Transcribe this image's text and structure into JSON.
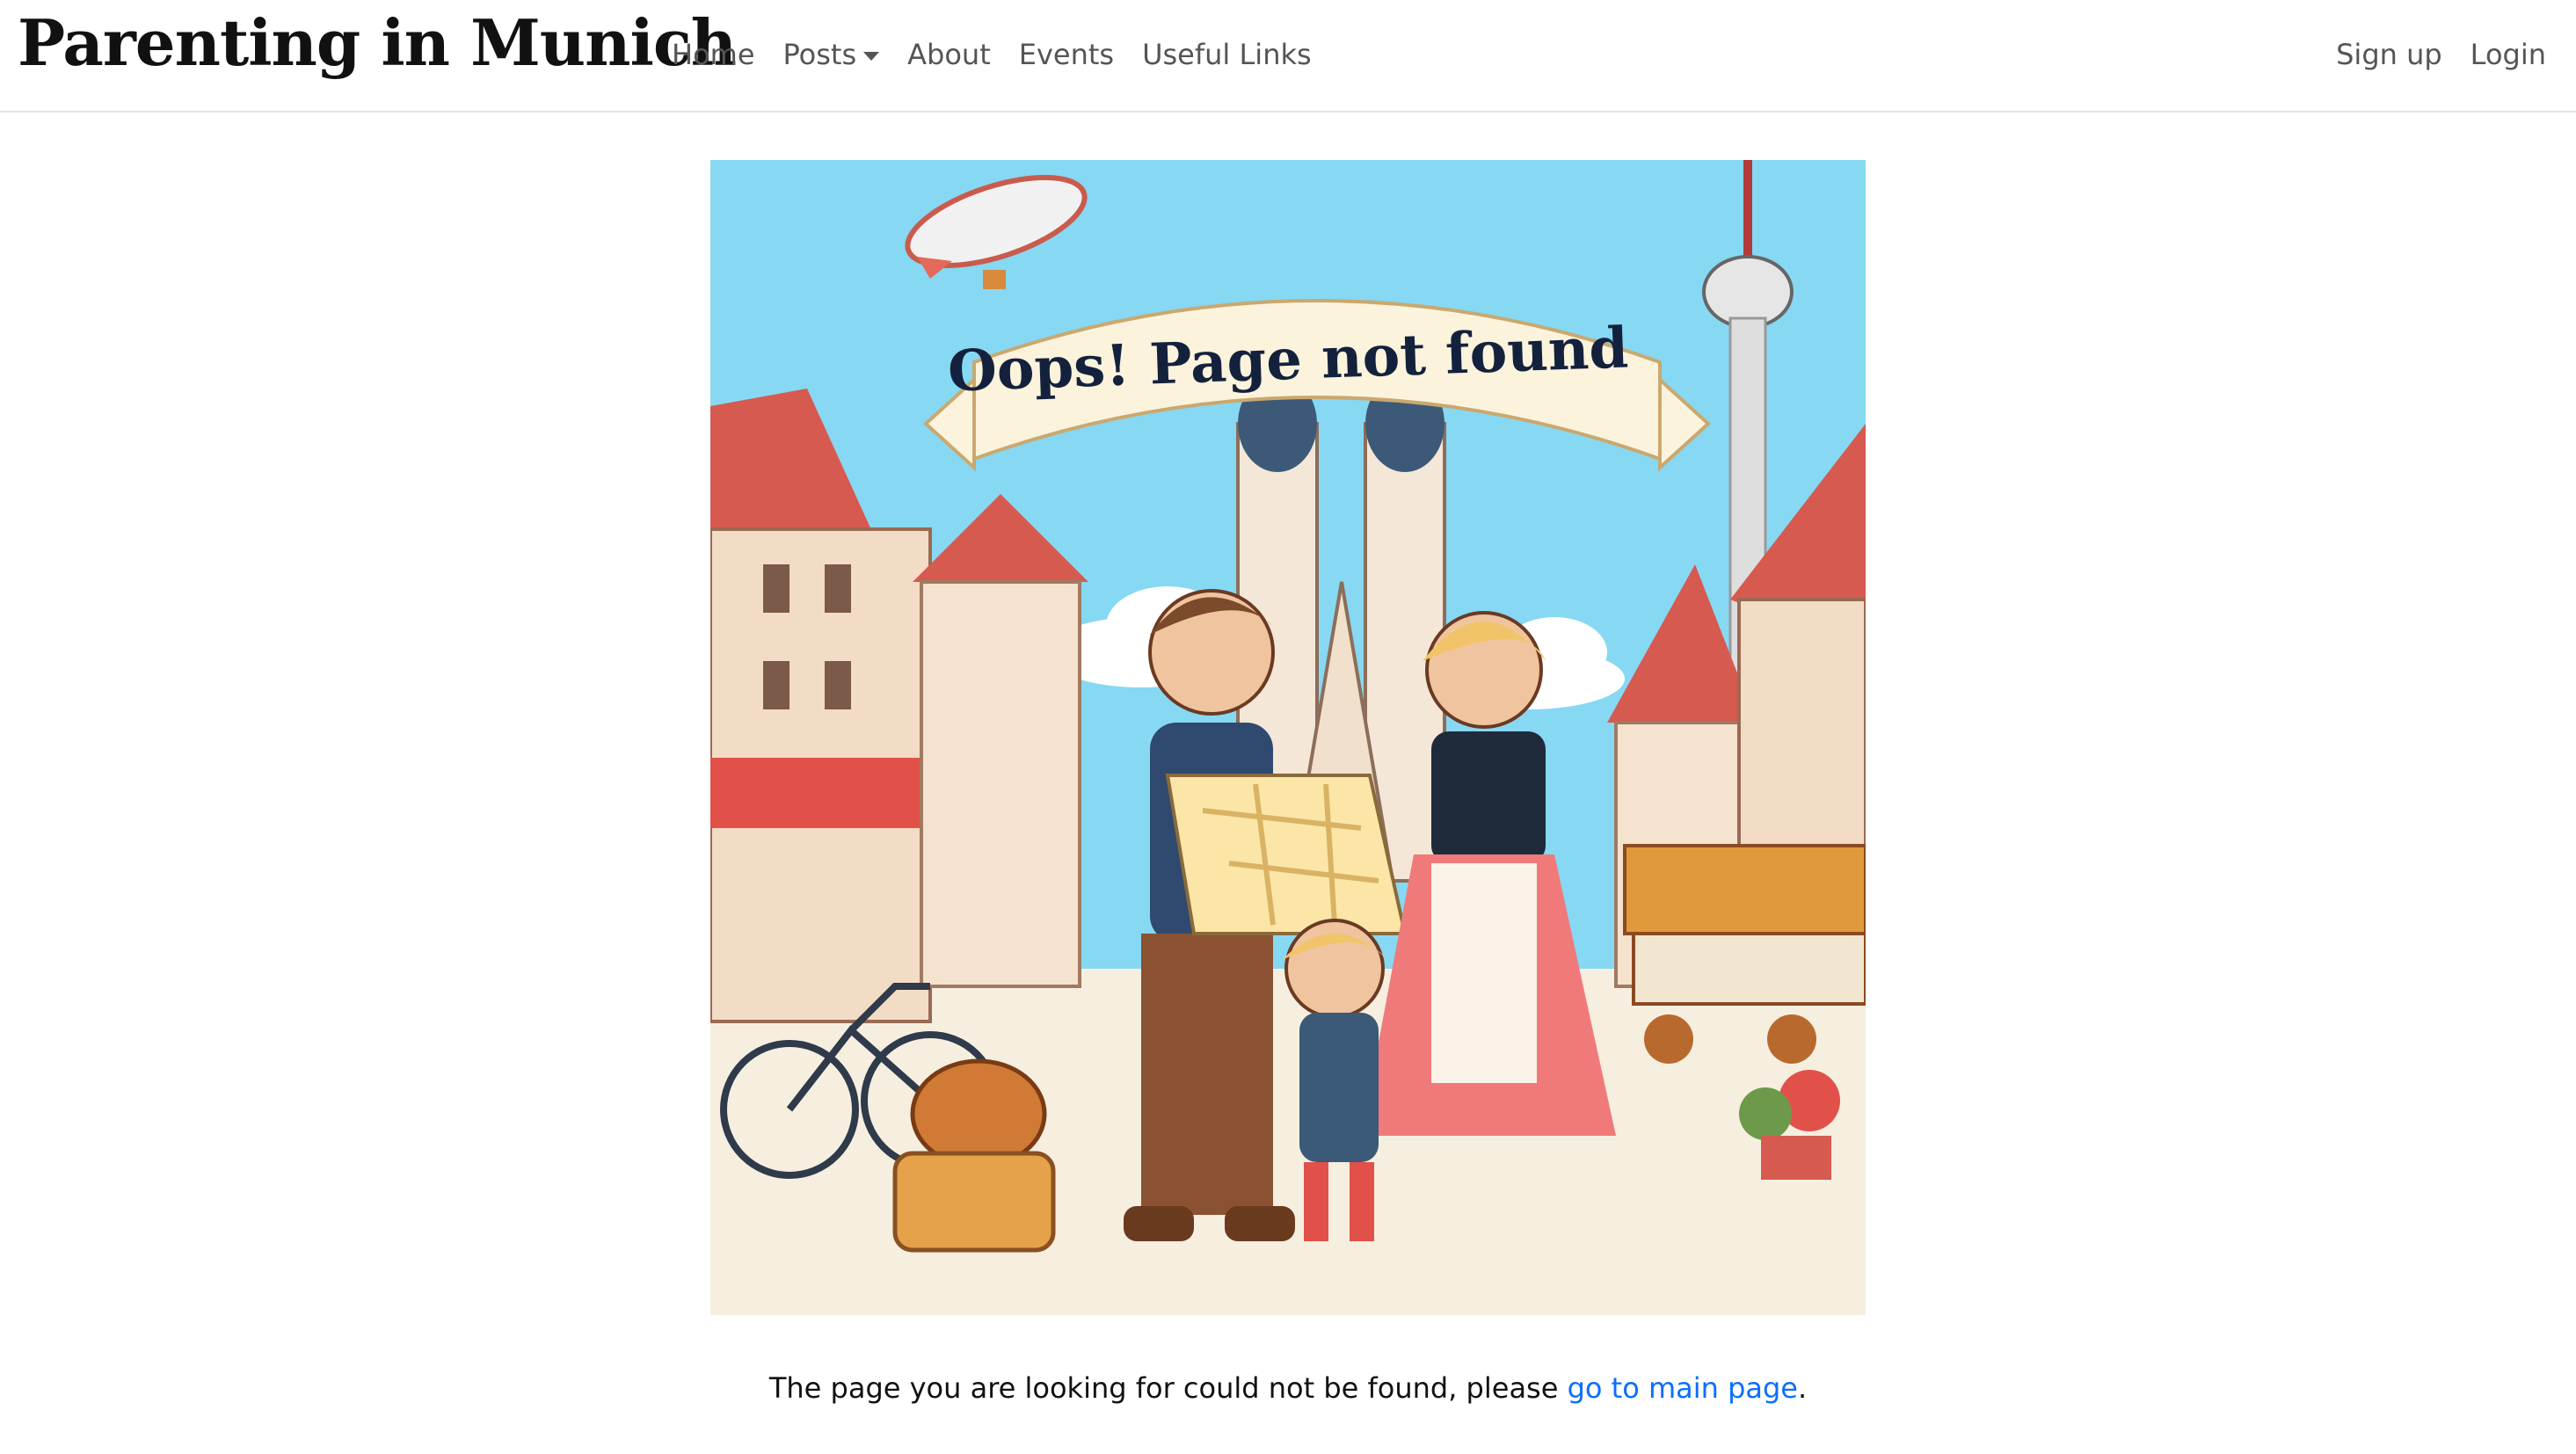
{
  "app": {
    "brand": "Parenting in Munich"
  },
  "nav": {
    "items": [
      {
        "label": "Home"
      },
      {
        "label": "Posts"
      },
      {
        "label": "About"
      },
      {
        "label": "Events"
      },
      {
        "label": "Useful Links"
      }
    ],
    "right": [
      {
        "label": "Sign up"
      },
      {
        "label": "Login"
      }
    ]
  },
  "illustration": {
    "banner_text": "Oops! Page not found",
    "colors": {
      "sky": "#87d8f3",
      "banner": "#fbf3dc",
      "roof": "#d65a50",
      "ground": "#f6efe0"
    }
  },
  "message": {
    "text": "The page you are looking for could not be found, please ",
    "link_text": "go to main page",
    "suffix": "."
  },
  "theme": {
    "link_color": "#0d6efd"
  }
}
